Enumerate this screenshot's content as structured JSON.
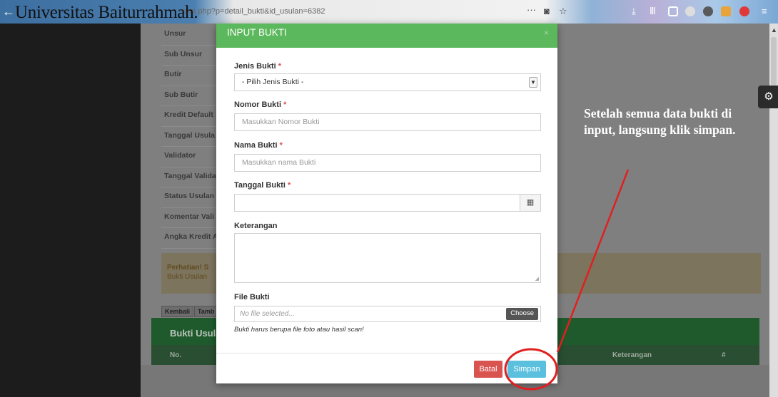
{
  "browser": {
    "overlay_title": "Universitas Baiturrahmah.",
    "url_fragment": "ama.php?p=detail_bukti&id_usulan=6382",
    "menu_dots": "···",
    "back_glyph": "←",
    "icons": [
      "download-icon",
      "library-icon",
      "sidebar-icon",
      "extension-icon",
      "menu-icon"
    ]
  },
  "background": {
    "info_labels": [
      "Unsur",
      "Sub Unsur",
      "Butir",
      "Sub Butir",
      "Kredit Default",
      "Tanggal Usula",
      "Validator",
      "Tanggal Valida",
      "Status Usulan",
      "Komentar Vali",
      "Angka Kredit A"
    ],
    "alert_title": "Perhatian! S",
    "alert_sub": "Bukti Usulan",
    "btn_kembali": "Kembali",
    "btn_tambah": "Tamb",
    "table_title": "Bukti Usula",
    "col_no": "No.",
    "col_keterangan": "Keterangan",
    "col_hash": "#"
  },
  "modal": {
    "title": "INPUT BUKTI",
    "close": "×",
    "jenis_label": "Jenis Bukti",
    "jenis_value": "- Pilih Jenis Bukti -",
    "nomor_label": "Nomor Bukti",
    "nomor_placeholder": "Masukkan Nomor Bukti",
    "nama_label": "Nama Bukti",
    "nama_placeholder": "Masukkan nama Bukti",
    "tanggal_label": "Tanggal Bukti",
    "tanggal_value": "",
    "keterangan_label": "Keterangan",
    "file_label": "File Bukti",
    "file_placeholder": "No file selected...",
    "choose_label": "Choose",
    "help_text": "Bukti harus berupa file foto atau hasil scan!",
    "batal_label": "Batal",
    "simpan_label": "Simpan",
    "required_mark": "*"
  },
  "annotation": {
    "note": "Setelah semua data bukti di input, langsung klik simpan.",
    "color": "#e02020"
  }
}
